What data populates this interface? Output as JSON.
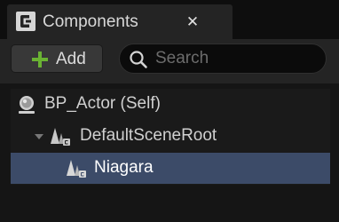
{
  "tab": {
    "title": "Components",
    "close_glyph": "✕",
    "icon": "components-icon"
  },
  "toolbar": {
    "add_label": "Add",
    "add_icon": "plus-icon",
    "search_placeholder": "Search",
    "search_value": "",
    "search_icon": "search-icon"
  },
  "tree": {
    "items": [
      {
        "label": "BP_Actor (Self)",
        "icon": "actor-sphere-icon",
        "selected": false
      },
      {
        "label": "DefaultSceneRoot",
        "icon": "scene-component-icon",
        "expanded": true,
        "selected": false
      },
      {
        "label": "Niagara",
        "icon": "scene-component-icon",
        "selected": true
      }
    ]
  },
  "colors": {
    "selection": "#3c4b68",
    "add_plus": "#6ab233"
  }
}
